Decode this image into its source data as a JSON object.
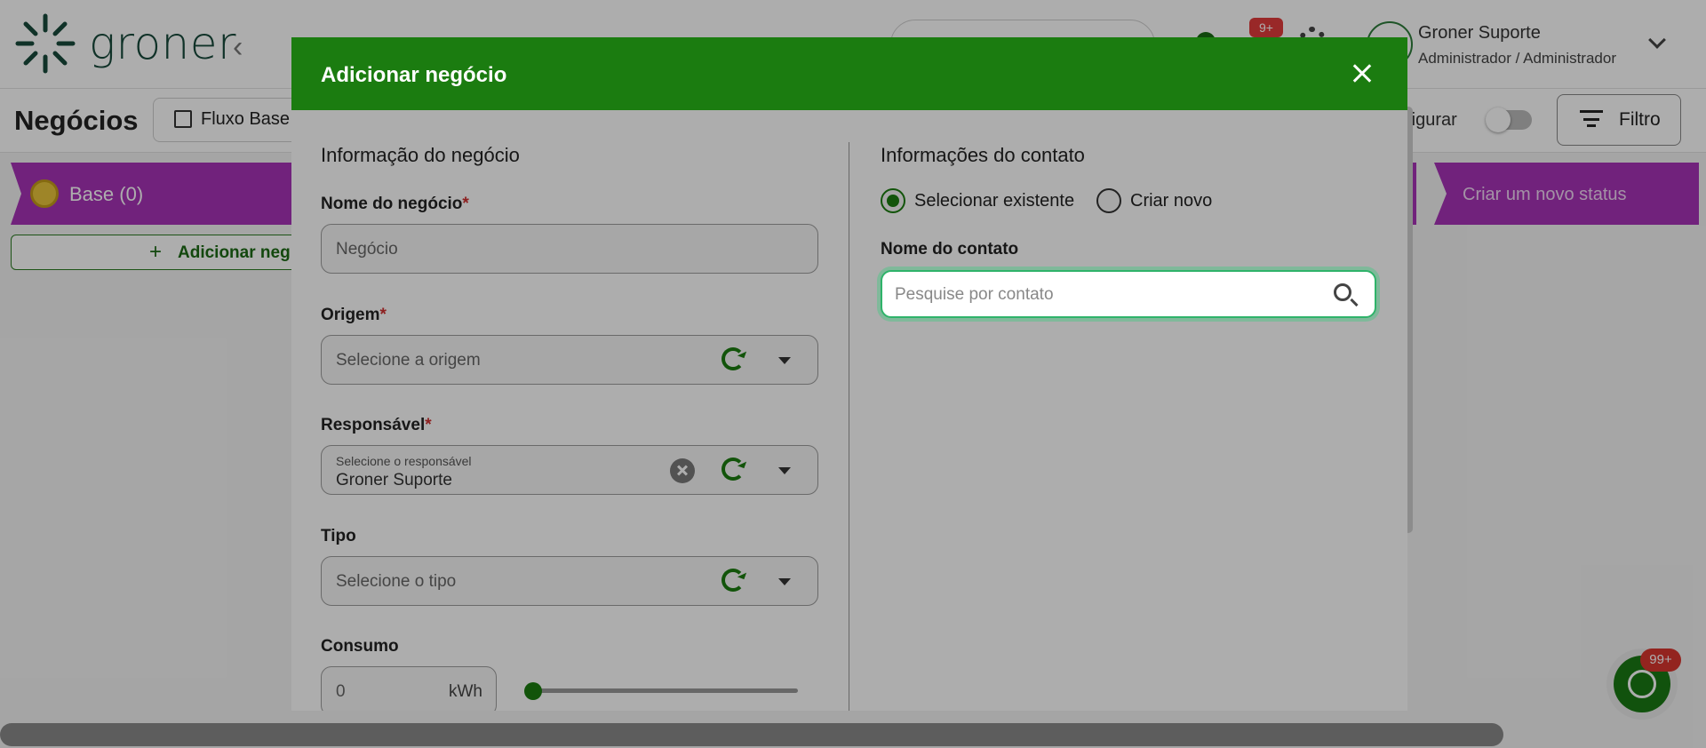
{
  "app": {
    "logo_text": "groner",
    "user": {
      "name": "Groner Suporte",
      "role": "Administrador / Administrador"
    },
    "notifications_badge": "9+"
  },
  "page": {
    "title": "Negócios",
    "flow_select": "Fluxo Base",
    "config_label": "nfigurar",
    "filter_label": "Filtro"
  },
  "board": {
    "column_title": "Base (0)",
    "add_deal_label": "Adicionar neg",
    "new_status_label": "Criar um novo status"
  },
  "whatsapp": {
    "badge": "99+"
  },
  "modal": {
    "title": "Adicionar negócio",
    "deal_section": {
      "title": "Informação do negócio",
      "name": {
        "label": "Nome do negócio",
        "required_mark": "*",
        "placeholder": "Negócio"
      },
      "origin": {
        "label": "Origem",
        "required_mark": "*",
        "placeholder": "Selecione a origem"
      },
      "owner": {
        "label": "Responsável",
        "required_mark": "*",
        "small_label": "Selecione o responsável",
        "value": "Groner Suporte"
      },
      "type": {
        "label": "Tipo",
        "placeholder": "Selecione o tipo"
      },
      "consumption": {
        "label": "Consumo",
        "value": "0",
        "unit": "kWh",
        "slider_fraction": 0
      }
    },
    "contact_section": {
      "title": "Informações do contato",
      "radio_existing": "Selecionar existente",
      "radio_new": "Criar novo",
      "selected": "existing",
      "contact_name_label": "Nome do contato",
      "search_placeholder": "Pesquise por contato"
    }
  },
  "colors": {
    "primary_green": "#1b7c10",
    "column_purple": "#a733b7",
    "badge_red": "#d9352f"
  }
}
